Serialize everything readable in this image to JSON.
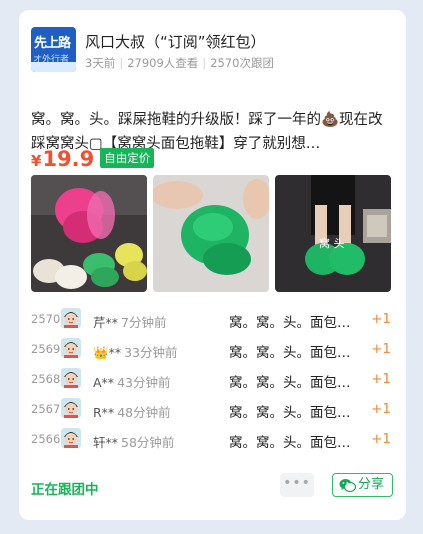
{
  "account": {
    "avatar_text_top": "先上路",
    "avatar_text_bottom": "オ外行者",
    "title": "风口大叔（“订阅”领红包）",
    "posted": "3天前",
    "views": "27909人查看",
    "followers": "2570次跟团"
  },
  "post": {
    "description": "窝。窝。头。踩屎拖鞋的升级版！踩了一年的💩现在改踩窝窝头▢【窝窝头面包拖鞋】穿了就别想…",
    "price_symbol": "¥",
    "price": "19.9",
    "price_tag": "自由定价",
    "photo_caption": "窝 头"
  },
  "group_orders": [
    {
      "num": "2570",
      "user": "芹**",
      "time": "7分钟前",
      "item": "窝。窝。头。面包…",
      "qty": "+1",
      "avatar_icon": "boy-avatar-icon"
    },
    {
      "num": "2569",
      "user": "👑**",
      "time": "33分钟前",
      "item": "窝。窝。头。面包…",
      "qty": "+1",
      "avatar_icon": "boy-avatar-icon"
    },
    {
      "num": "2568",
      "user": "A**",
      "time": "43分钟前",
      "item": "窝。窝。头。面包…",
      "qty": "+1",
      "avatar_icon": "boy-avatar-icon"
    },
    {
      "num": "2567",
      "user": "R**",
      "time": "48分钟前",
      "item": "窝。窝。头。面包…",
      "qty": "+1",
      "avatar_icon": "boy-avatar-icon"
    },
    {
      "num": "2566",
      "user": "轩**",
      "time": "58分钟前",
      "item": "窝。窝。头。面包…",
      "qty": "+1",
      "avatar_icon": "boy-avatar-icon"
    }
  ],
  "footer": {
    "following": "正在跟团中",
    "more": "•••",
    "share": "分享"
  },
  "colors": {
    "accent_green": "#17b45a",
    "price_red": "#f2502e",
    "plus_orange": "#f08a3d",
    "page_bg": "#e3eaf3"
  }
}
